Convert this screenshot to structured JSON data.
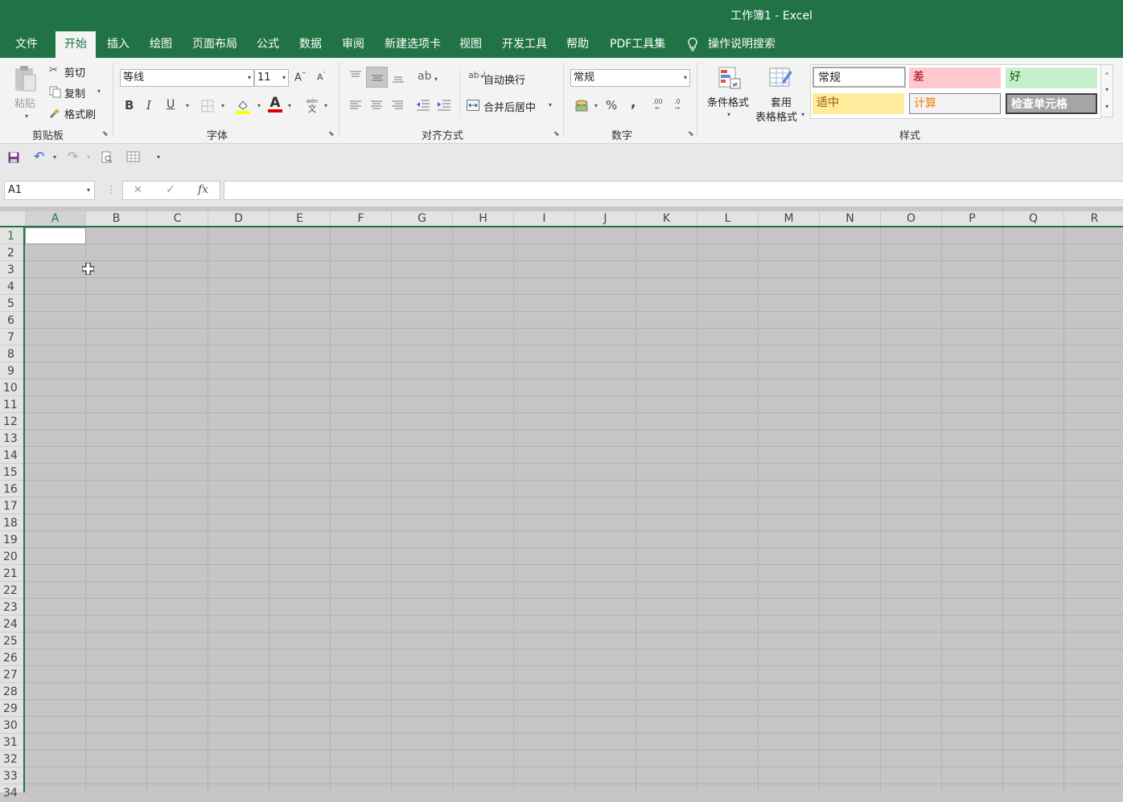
{
  "window": {
    "title": "工作簿1  -  Excel"
  },
  "tabs": [
    {
      "label": "文件"
    },
    {
      "label": "开始"
    },
    {
      "label": "插入"
    },
    {
      "label": "绘图"
    },
    {
      "label": "页面布局"
    },
    {
      "label": "公式"
    },
    {
      "label": "数据"
    },
    {
      "label": "审阅"
    },
    {
      "label": "新建选项卡"
    },
    {
      "label": "视图"
    },
    {
      "label": "开发工具"
    },
    {
      "label": "帮助"
    },
    {
      "label": "PDF工具集"
    }
  ],
  "active_tab": "开始",
  "tell_me": {
    "label": "操作说明搜索"
  },
  "clipboard": {
    "group": "剪贴板",
    "paste": "粘贴",
    "cut": "剪切",
    "copy": "复制",
    "format_painter": "格式刷"
  },
  "font": {
    "group": "字体",
    "name": "等线",
    "size": "11",
    "grow": "A",
    "shrink": "A",
    "bold": "B",
    "italic": "I",
    "underline": "U",
    "font_color_glyph": "A",
    "phonetic_top": "wén",
    "phonetic_bottom": "文"
  },
  "alignment": {
    "group": "对齐方式",
    "wrap_text": "自动换行",
    "merge_center": "合并后居中"
  },
  "number": {
    "group": "数字",
    "format": "常规",
    "percent": "%",
    "comma": ",",
    "inc_decimal": ".00",
    "dec_decimal": ".0"
  },
  "styles": {
    "group": "样式",
    "conditional_formatting": "条件格式",
    "format_as_table_line1": "套用",
    "format_as_table_line2": "表格格式",
    "cells": [
      {
        "label": "常规",
        "bg": "#ffffff",
        "fg": "#000000"
      },
      {
        "label": "差",
        "bg": "#ffc7ce",
        "fg": "#9c0006"
      },
      {
        "label": "好",
        "bg": "#c6efce",
        "fg": "#006100"
      },
      {
        "label": "适中",
        "bg": "#ffeb9c",
        "fg": "#9c5700"
      },
      {
        "label": "计算",
        "bg": "#f2f2f2",
        "fg": "#fa7d00"
      },
      {
        "label": "检查单元格",
        "bg": "#a5a5a5",
        "fg": "#ffffff"
      }
    ]
  },
  "formula_bar": {
    "name_box": "A1",
    "cancel": "✕",
    "enter": "✓",
    "fx": "fx",
    "value": ""
  },
  "columns": [
    "A",
    "B",
    "C",
    "D",
    "E",
    "F",
    "G",
    "H",
    "I",
    "J",
    "K",
    "L",
    "M",
    "N",
    "O",
    "P",
    "Q",
    "R"
  ],
  "rows": [
    "1",
    "2",
    "3",
    "4",
    "5",
    "6",
    "7",
    "8",
    "9",
    "10",
    "11",
    "12",
    "13",
    "14",
    "15",
    "16",
    "17",
    "18",
    "19",
    "20",
    "21",
    "22",
    "23",
    "24",
    "25",
    "26",
    "27",
    "28",
    "29",
    "30",
    "31",
    "32",
    "33",
    "34"
  ],
  "colors": {
    "brand": "#217346",
    "ribbon_bg": "#f3f3f3",
    "grid_bg": "#c6c4c6"
  }
}
